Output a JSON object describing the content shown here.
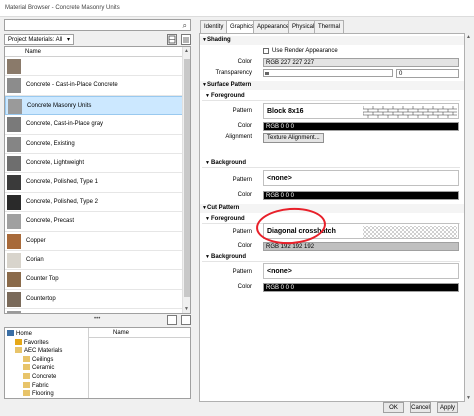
{
  "window": {
    "title": "Material Browser - Concrete Masonry Units"
  },
  "left": {
    "search_placeholder": "",
    "filter_label": "Project Materials: All",
    "column_name": "Name",
    "materials": [
      {
        "label": "",
        "color": "#8a7a6a"
      },
      {
        "label": "Concrete - Cast-in-Place Concrete",
        "color": "#8c8c8c"
      },
      {
        "label": "Concrete Masonry Units",
        "color": "#9a9a9a",
        "selected": true
      },
      {
        "label": "Concrete, Cast-in-Place gray",
        "color": "#7a7a7a"
      },
      {
        "label": "Concrete, Existing",
        "color": "#858585"
      },
      {
        "label": "Concrete, Lightweight",
        "color": "#6e6e6e"
      },
      {
        "label": "Concrete, Polished, Type 1",
        "color": "#3a3a3a"
      },
      {
        "label": "Concrete, Polished, Type 2",
        "color": "#2a2a2a"
      },
      {
        "label": "Concrete, Precast",
        "color": "#a0a0a0"
      },
      {
        "label": "Copper",
        "color": "#a86a3a"
      },
      {
        "label": "Corian",
        "color": "#d8d4cc"
      },
      {
        "label": "Counter Top",
        "color": "#8a6a4a"
      },
      {
        "label": "Countertop",
        "color": "#7a6a5a"
      },
      {
        "label": "",
        "color": "#9a9a9a"
      },
      {
        "label": "",
        "color": "#b0a090"
      }
    ],
    "library": {
      "tree": [
        {
          "label": "Home",
          "level": 0,
          "icon": "home-icon"
        },
        {
          "label": "Favorites",
          "level": 1,
          "icon": "star-icon"
        },
        {
          "label": "AEC Materials",
          "level": 1,
          "icon": "folder-icon"
        },
        {
          "label": "Ceilings",
          "level": 2,
          "icon": "folder-icon"
        },
        {
          "label": "Ceramic",
          "level": 2,
          "icon": "folder-icon"
        },
        {
          "label": "Concrete",
          "level": 2,
          "icon": "folder-icon"
        },
        {
          "label": "Fabric",
          "level": 2,
          "icon": "folder-icon"
        },
        {
          "label": "Flooring",
          "level": 2,
          "icon": "folder-icon"
        }
      ],
      "column_name": "Name"
    }
  },
  "tabs": [
    "Identity",
    "Graphics",
    "Appearance",
    "Physical",
    "Thermal"
  ],
  "graphics": {
    "shading": {
      "header": "Shading",
      "use_render_label": "Use Render Appearance",
      "color_label": "Color",
      "color_value": "RGB 227 227 227",
      "color_swatch": "#e3e3e3",
      "transparency_label": "Transparency",
      "transparency_value": "0"
    },
    "surface_pattern": {
      "header": "Surface Pattern",
      "foreground": {
        "header": "Foreground",
        "pattern_label": "Pattern",
        "pattern_name": "Block 8x16",
        "color_label": "Color",
        "color_value": "RGB 0 0 0",
        "alignment_label": "Alignment",
        "alignment_button": "Texture Alignment..."
      },
      "background": {
        "header": "Background",
        "pattern_label": "Pattern",
        "pattern_name": "<none>",
        "color_label": "Color",
        "color_value": "RGB 0 0 0"
      }
    },
    "cut_pattern": {
      "header": "Cut Pattern",
      "foreground": {
        "header": "Foreground",
        "pattern_label": "Pattern",
        "pattern_name": "Diagonal crosshatch",
        "color_label": "Color",
        "color_value": "RGB 192 192 192",
        "color_swatch": "#c0c0c0"
      },
      "background": {
        "header": "Background",
        "pattern_label": "Pattern",
        "pattern_name": "<none>",
        "color_label": "Color",
        "color_value": "RGB 0 0 0"
      }
    }
  },
  "buttons": {
    "ok": "OK",
    "cancel": "Cancel",
    "apply": "Apply"
  }
}
